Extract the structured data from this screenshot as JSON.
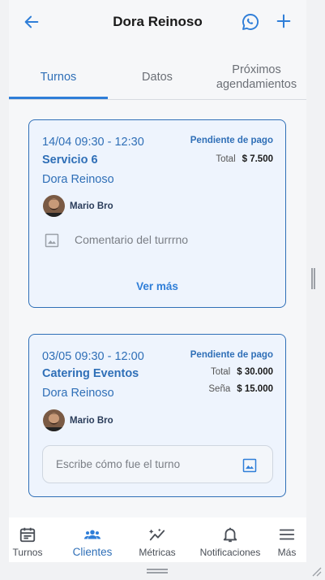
{
  "header": {
    "title": "Dora Reinoso",
    "back_icon": "arrow-left-icon",
    "whatsapp_icon": "whatsapp-icon",
    "add_icon": "plus-icon"
  },
  "tabs": [
    {
      "label": "Turnos",
      "active": true
    },
    {
      "label": "Datos",
      "active": false
    },
    {
      "label": "Próximos agendamientos",
      "active": false
    }
  ],
  "cards": [
    {
      "datetime": "14/04 09:30 - 12:30",
      "service": "Servicio 6",
      "client": "Dora Reinoso",
      "status": "Pendiente de pago",
      "total_label": "Total",
      "total_value": "$ 7.500",
      "professional": "Mario Bro",
      "comment": "Comentario del turrrno",
      "more_label": "Ver más"
    },
    {
      "datetime": "03/05 09:30 - 12:00",
      "service": "Catering Eventos",
      "client": "Dora Reinoso",
      "status": "Pendiente de pago",
      "total_label": "Total",
      "total_value": "$ 30.000",
      "deposit_label": "Seña",
      "deposit_value": "$ 15.000",
      "professional": "Mario Bro",
      "input_placeholder": "Escribe cómo fue el turno"
    }
  ],
  "bottom_nav": [
    {
      "label": "Turnos",
      "icon": "calendar-icon",
      "active": false
    },
    {
      "label": "Clientes",
      "icon": "people-icon",
      "active": true
    },
    {
      "label": "Métricas",
      "icon": "chart-icon",
      "active": false
    },
    {
      "label": "Notificaciones",
      "icon": "bell-icon",
      "active": false
    },
    {
      "label": "Más",
      "icon": "menu-icon",
      "active": false
    }
  ],
  "colors": {
    "accent": "#2f7ed8",
    "accent_dark": "#2f6fb7",
    "card_bg": "#eef4fd"
  }
}
